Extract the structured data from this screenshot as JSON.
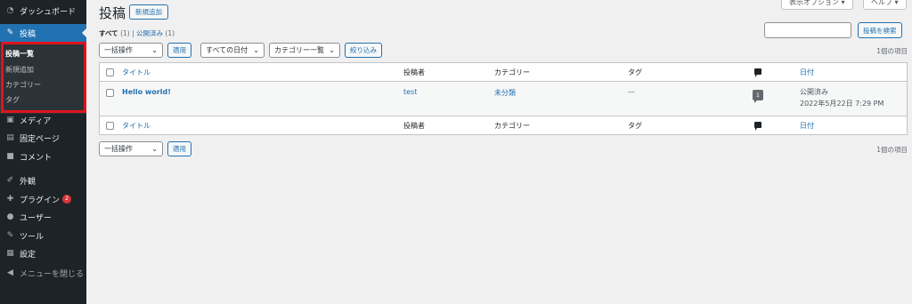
{
  "sidebar": {
    "dashboard": "ダッシュボード",
    "posts": "投稿",
    "submenu": {
      "all_posts": "投稿一覧",
      "add_new": "新規追加",
      "categories": "カテゴリー",
      "tags": "タグ"
    },
    "media": "メディア",
    "pages": "固定ページ",
    "comments": "コメント",
    "appearance": "外観",
    "plugins": "プラグイン",
    "plugins_badge": "2",
    "users": "ユーザー",
    "tools": "ツール",
    "settings": "設定",
    "collapse": "メニューを閉じる"
  },
  "header": {
    "screen_options": "表示オプション ▾",
    "help": "ヘルプ ▾",
    "title": "投稿",
    "add_new": "新規追加"
  },
  "filters": {
    "all_label": "すべて",
    "all_count": "(1)",
    "separator": "|",
    "published_label": "公開済み",
    "published_count": "(1)"
  },
  "search": {
    "placeholder": "",
    "button": "投稿を検索"
  },
  "top_nav": {
    "bulk_action": "一括操作",
    "apply": "適用",
    "dates": "すべての日付",
    "categories": "カテゴリー一覧",
    "filter": "絞り込み",
    "item_count": "1個の項目"
  },
  "bottom_nav": {
    "bulk_action": "一括操作",
    "apply": "適用",
    "item_count": "1個の項目"
  },
  "table": {
    "columns": {
      "title": "タイトル",
      "author": "投稿者",
      "categories": "カテゴリー",
      "tags": "タグ",
      "date": "日付"
    },
    "rows": [
      {
        "title": "Hello world!",
        "author": "test",
        "category": "未分類",
        "tags": "—",
        "comments": "1",
        "status": "公開済み",
        "date": "2022年5月22日 7:29 PM"
      }
    ]
  },
  "colors": {
    "sidebar_bg": "#1d2327",
    "accent": "#2271b1",
    "highlight_border": "#e0141e",
    "badge": "#d63638"
  }
}
